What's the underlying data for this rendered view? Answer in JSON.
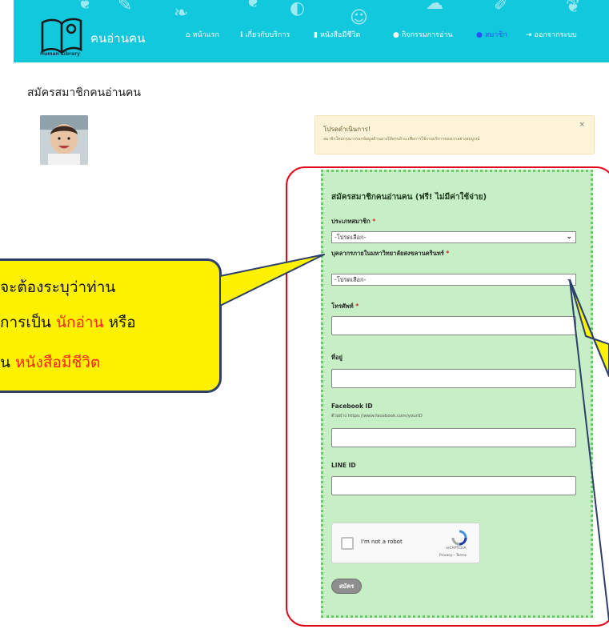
{
  "navbar": {
    "brand": "คนอ่านคน",
    "logo_caption": "Human Library",
    "items": [
      {
        "icon": "home-icon",
        "glyph": "🏠",
        "label": "หน้าแรก"
      },
      {
        "icon": "info-icon",
        "glyph": "ℹ",
        "label": "เกี่ยวกับบริการ"
      },
      {
        "icon": "book-icon",
        "glyph": "▆",
        "label": "หนังสือมีชีวิต"
      },
      {
        "icon": "chat-icon",
        "glyph": "●",
        "label": "กิจกรรมการอ่าน"
      },
      {
        "icon": "user-icon",
        "glyph": "👤",
        "label": "สมาชิก"
      },
      {
        "icon": "logout-icon",
        "glyph": "⇥",
        "label": "ออกจากระบบ"
      }
    ],
    "active_index": 4,
    "background": "#12c8dc"
  },
  "page": {
    "title": "สมัครสมาชิกคนอ่านคน"
  },
  "alert": {
    "title": "โปรดดำเนินการ!",
    "text": "สมาชิกใหม่กรุณากรอกข้อมูลด้านล่างให้ครบถ้วน เพื่อการใช้งานบริการของเราอย่างสมบูรณ์",
    "close": "×"
  },
  "form": {
    "heading": "สมัครสมาชิกคนอ่านคน (ฟรี! ไม่มีค่าใช้จ่าย)",
    "member_type": {
      "label": "ประเภทสมาชิก",
      "value": "-โปรดเลือก-"
    },
    "psu_staff": {
      "label": "บุคลากรภายในมหาวิทยาลัยสงขลานครินทร์",
      "value": "-โปรดเลือก-"
    },
    "phone": {
      "label": "โทรศัพท์",
      "value": ""
    },
    "address": {
      "label": "ที่อยู่",
      "value": ""
    },
    "facebook": {
      "label": "Facebook ID",
      "hint": "ตัวอย่าง https://www.facebook.com/yourID",
      "value": ""
    },
    "line": {
      "label": "LINE ID",
      "value": ""
    },
    "required_mark": "*",
    "captcha": {
      "label": "I'm not a robot",
      "brand": "reCAPTCHA",
      "links": "Privacy - Terms"
    },
    "submit": "สมัคร"
  },
  "callout": {
    "line1": "จะต้องระบุว่าท่าน",
    "line2_pre": "การเป็น ",
    "line2_red": "นักอ่าน",
    "line2_post": " หรือ",
    "line3_pre": "ุน ",
    "line3_red": "หนังสือมีชีวิต"
  },
  "colors": {
    "accent_red": "#e1071b",
    "form_green": "#c7efc5",
    "callout_yellow": "#fff200"
  }
}
